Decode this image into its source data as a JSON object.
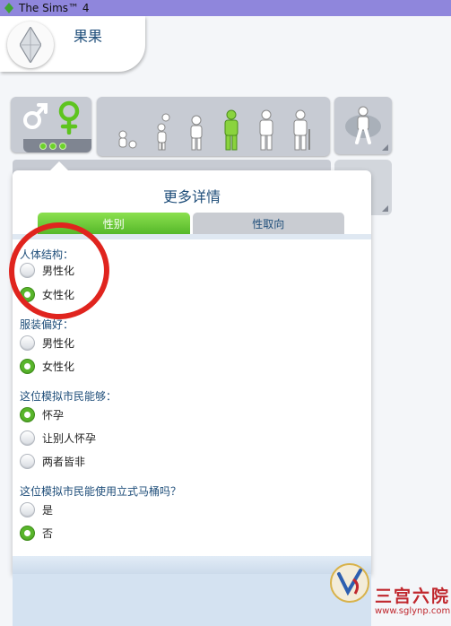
{
  "window": {
    "title": "The Sims™ 4"
  },
  "sim": {
    "name": "果果"
  },
  "panel": {
    "title": "更多详情",
    "tabs": [
      {
        "label": "性别"
      },
      {
        "label": "性取向"
      }
    ],
    "sections": [
      {
        "label": "人体结构：",
        "options": [
          {
            "label": "男性化",
            "checked": false
          },
          {
            "label": "女性化",
            "checked": true
          }
        ]
      },
      {
        "label": "服装偏好：",
        "options": [
          {
            "label": "男性化",
            "checked": false
          },
          {
            "label": "女性化",
            "checked": true
          }
        ]
      },
      {
        "label": "这位模拟市民能够：",
        "options": [
          {
            "label": "怀孕",
            "checked": true
          },
          {
            "label": "让别人怀孕",
            "checked": false
          },
          {
            "label": "两者皆非",
            "checked": false
          }
        ]
      },
      {
        "label": "这位模拟市民能使用立式马桶吗？",
        "options": [
          {
            "label": "是",
            "checked": false
          },
          {
            "label": "否",
            "checked": true
          }
        ]
      }
    ]
  },
  "watermark": {
    "text": "三宫六院",
    "url": "www.sglynp.com"
  },
  "colors": {
    "accent_green": "#58b52b",
    "title_bar": "#8f86dc",
    "annotation_red": "#e0241e",
    "text_blue": "#1f4e7a"
  }
}
